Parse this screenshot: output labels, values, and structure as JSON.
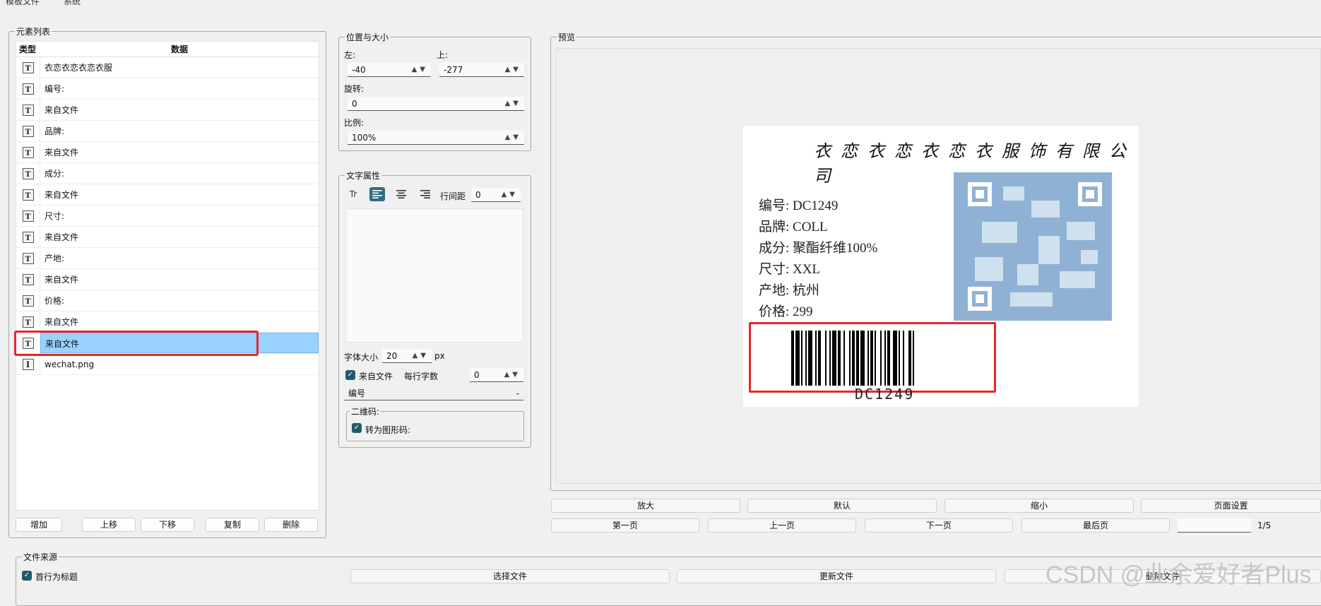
{
  "menu": [
    "模板文件",
    "系统"
  ],
  "element_list": {
    "legend": "元素列表",
    "headers": {
      "type": "类型",
      "data": "数据"
    },
    "rows": [
      {
        "icon": "T",
        "text": "衣恋衣恋衣恋衣服"
      },
      {
        "icon": "T",
        "text": "编号:"
      },
      {
        "icon": "T",
        "text": "来自文件"
      },
      {
        "icon": "T",
        "text": "品牌:"
      },
      {
        "icon": "T",
        "text": "来自文件"
      },
      {
        "icon": "T",
        "text": "成分:"
      },
      {
        "icon": "T",
        "text": "来自文件"
      },
      {
        "icon": "T",
        "text": "尺寸:"
      },
      {
        "icon": "T",
        "text": "来自文件"
      },
      {
        "icon": "T",
        "text": "产地:"
      },
      {
        "icon": "T",
        "text": "来自文件"
      },
      {
        "icon": "T",
        "text": "价格:"
      },
      {
        "icon": "T",
        "text": "来自文件"
      },
      {
        "icon": "T",
        "text": "来自文件",
        "selected": true
      },
      {
        "icon": "I",
        "text": "wechat.png"
      }
    ],
    "buttons": {
      "add": "增加",
      "up": "上移",
      "down": "下移",
      "copy": "复制",
      "delete": "删除"
    }
  },
  "position": {
    "legend": "位置与大小",
    "left_label": "左:",
    "left_value": "-40",
    "top_label": "上:",
    "top_value": "-277",
    "rotate_label": "旋转:",
    "rotate_value": "0",
    "scale_label": "比例:",
    "scale_value": "100%"
  },
  "text_props": {
    "legend": "文字属性",
    "tool_format": "Tr",
    "line_spacing_label": "行间距",
    "line_spacing_value": "0",
    "font_size_label": "字体大小",
    "font_size_value": "20",
    "font_size_unit": "px",
    "from_file_label": "来自文件",
    "from_file_checked": true,
    "chars_per_line_label": "每行字数",
    "chars_per_line_value": "0",
    "field_select": "编号",
    "qr_legend": "二维码:",
    "to_barcode_label": "转为图形码:",
    "to_barcode_checked": true
  },
  "preview": {
    "legend": "预览",
    "label": {
      "title": "衣恋衣恋衣恋衣服饰有限公司",
      "lines": [
        "编号: DC1249",
        "品牌: COLL",
        "成分: 聚酯纤维100%",
        "尺寸: XXL",
        "产地: 杭州",
        "价格: 299"
      ],
      "barcode_text": "DC1249"
    },
    "buttons": {
      "zoom_in": "放大",
      "default": "默认",
      "zoom_out": "缩小",
      "page_setup": "页面设置"
    },
    "nav": {
      "first": "第一页",
      "prev": "上一页",
      "next": "下一页",
      "last": "最后页"
    },
    "page_indicator": "1/5"
  },
  "file_source": {
    "legend": "文件来源",
    "first_row_header_label": "首行为标题",
    "first_row_header_checked": true,
    "select_file": "选择文件",
    "update_file": "更新文件",
    "delete_file": "删除文件"
  },
  "watermark": "CSDN @业余爱好者Plus",
  "colors": {
    "highlight": "#e8252b",
    "selection": "#99d1ff",
    "accent": "#2e6d80"
  }
}
